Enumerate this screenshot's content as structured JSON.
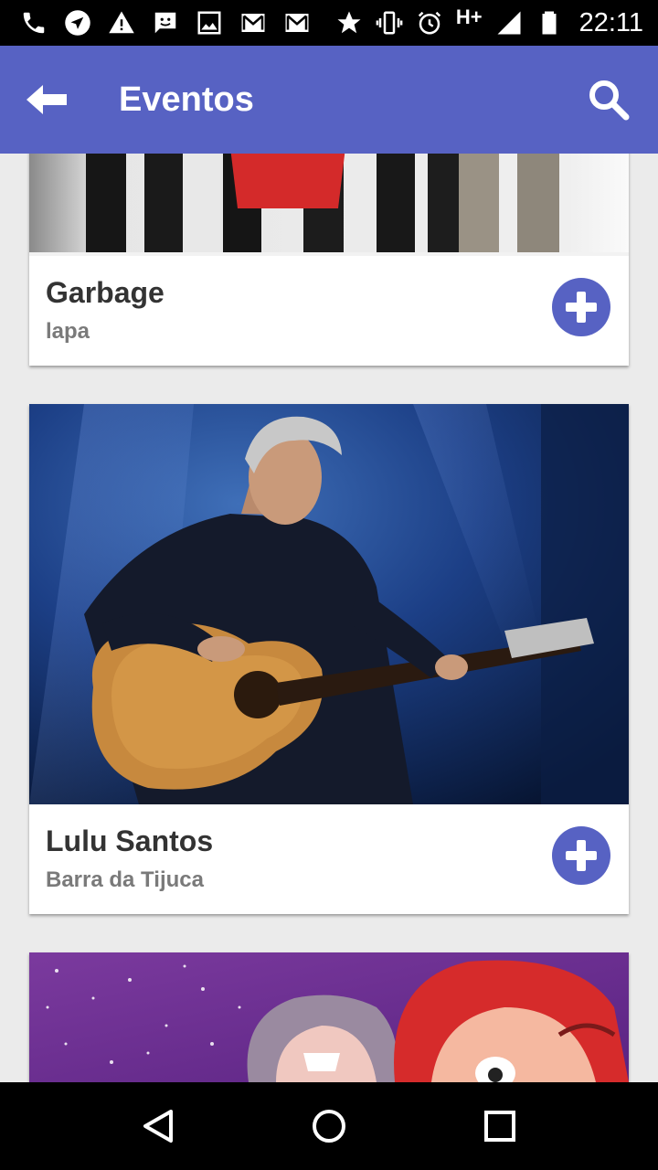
{
  "status_bar": {
    "network": "H+",
    "time": "22:11",
    "icons": [
      "phone-icon",
      "navigation-icon",
      "warning-icon",
      "message-icon",
      "image-icon",
      "gmail-icon",
      "gmail-icon",
      "star-icon",
      "vibrate-icon",
      "alarm-icon",
      "signal-icon",
      "battery-icon"
    ]
  },
  "app_bar": {
    "title": "Eventos",
    "back_icon": "arrow-back-icon",
    "search_icon": "search-icon",
    "color": "#5762c3"
  },
  "events": [
    {
      "name": "Garbage",
      "location": "lapa",
      "action_icon": "add-circle-icon"
    },
    {
      "name": "Lulu Santos",
      "location": "Barra da Tijuca",
      "action_icon": "add-circle-icon"
    },
    {
      "name": "",
      "location": "",
      "action_icon": ""
    }
  ],
  "nav_bar": {
    "back_icon": "nav-back-icon",
    "home_icon": "nav-home-icon",
    "recents_icon": "nav-recents-icon"
  }
}
